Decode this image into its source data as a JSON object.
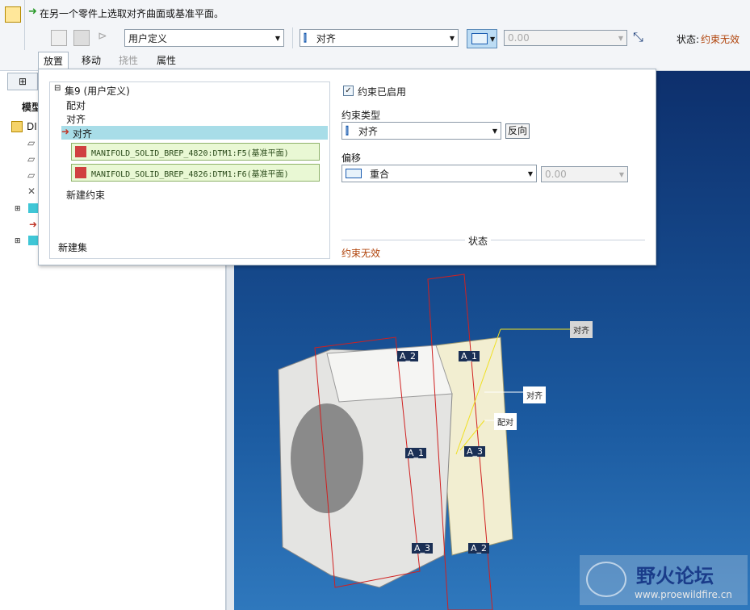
{
  "prompt": {
    "text": "在另一个零件上选取对齐曲面或基准平面。"
  },
  "toolbar": {
    "set_type": "用户定义",
    "constraint": "对齐",
    "offset_value": "0.00",
    "status_label": "状态:",
    "status_value": "约束无效"
  },
  "tabs": [
    {
      "label": "放置"
    },
    {
      "label": "移动"
    },
    {
      "label": "挠性"
    },
    {
      "label": "属性"
    }
  ],
  "model_tree": {
    "title": "模型",
    "root": "DI"
  },
  "panel": {
    "set_title": "集9 (用户定义)",
    "items": [
      "配对",
      "对齐"
    ],
    "active": "对齐",
    "refs": [
      "MANIFOLD_SOLID_BREP_4820:DTM1:F5(基准平面)",
      "MANIFOLD_SOLID_BREP_4826:DTM1:F6(基准平面)"
    ],
    "new_constraint": "新建约束",
    "new_set": "新建集",
    "enabled_label": "约束已启用",
    "type_label": "约束类型",
    "type_value": "对齐",
    "flip_label": "反向",
    "offset_label": "偏移",
    "offset_value": "重合",
    "offset_number": "0.00",
    "status_section": "状态",
    "status_text": "约束无效"
  },
  "viewport": {
    "labels": [
      "A_2",
      "A_1",
      "A_1",
      "A_3",
      "A_3",
      "A_2"
    ],
    "callouts": [
      "对齐",
      "对齐",
      "配对"
    ]
  },
  "watermark": {
    "title": "野火论坛",
    "url": "www.proewildfire.cn"
  },
  "colors": {
    "accent": "#c0392b",
    "status": "#b0430a",
    "highlight": "#a8dde8"
  }
}
